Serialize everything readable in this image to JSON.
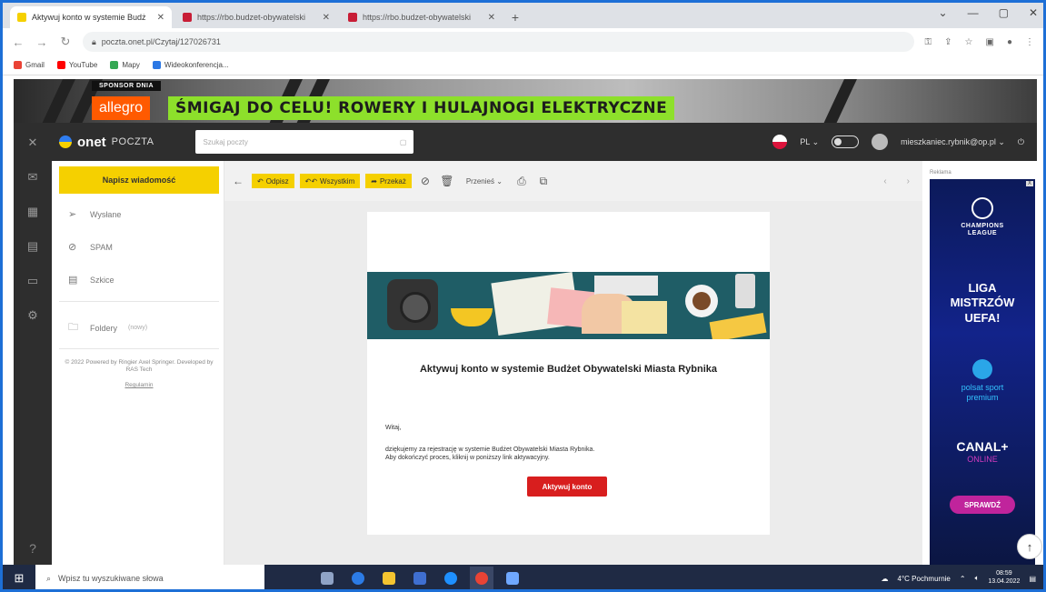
{
  "browser": {
    "tabs": [
      {
        "title": "Aktywuj konto w systemie Budż",
        "favicon_color": "#f5d000"
      },
      {
        "title": "https://rbo.budzet-obywatelski",
        "favicon_color": "#c81d36"
      },
      {
        "title": "https://rbo.budzet-obywatelski",
        "favicon_color": "#c81d36"
      }
    ],
    "url": "poczta.onet.pl/Czytaj/127026731",
    "bookmarks": [
      {
        "label": "Gmail",
        "color": "#ea4335"
      },
      {
        "label": "YouTube",
        "color": "#ff0000"
      },
      {
        "label": "Mapy",
        "color": "#34a853"
      },
      {
        "label": "Wideokonferencja...",
        "color": "#2b78e4"
      }
    ]
  },
  "banner": {
    "sponsor": "SPONSOR DNIA",
    "brand": "allegro",
    "promo": "ŚMIGAJ DO CELU! ROWERY I HULAJNOGI ELEKTRYCZNE"
  },
  "header": {
    "logo": "onet",
    "logo_sub": "POCZTA",
    "search_placeholder": "Szukaj poczty",
    "lang": "PL",
    "user": "mieszkaniec.rybnik@op.pl"
  },
  "sidebar": {
    "compose": "Napisz wiadomość",
    "items": [
      {
        "label": "Wysłane",
        "icon": "send-icon"
      },
      {
        "label": "SPAM",
        "icon": "spam-icon"
      },
      {
        "label": "Szkice",
        "icon": "draft-icon"
      }
    ],
    "folders": "Foldery",
    "folders_hint": "(nowy)",
    "footer": "© 2022 Powered by Ringier Axel Springer. Developed by RAS Tech",
    "footer_link": "Regulamin"
  },
  "toolbar": {
    "reply": "Odpisz",
    "reply_all": "Wszystkim",
    "forward": "Przekaż",
    "move": "Przenieś"
  },
  "email": {
    "title": "Aktywuj konto w systemie Budżet Obywatelski Miasta Rybnika",
    "greeting": "Witaj,",
    "body_line1": "dziękujemy za rejestrację w systemie Budżet Obywatelski Miasta Rybnika.",
    "body_line2": "Aby dokończyć proces, kliknij w poniższy link aktywacyjny.",
    "button": "Aktywuj konto"
  },
  "ad": {
    "label": "Reklama",
    "close": "X",
    "cl_line1": "CHAMPIONS",
    "cl_line2": "LEAGUE",
    "liga1": "LIGA",
    "liga2": "MISTRZÓW",
    "liga3": "UEFA!",
    "polsat1": "polsat sport",
    "polsat2": "premium",
    "canal": "CANAL+",
    "canal_sub": "ONLINE",
    "cta": "SPRAWDŹ"
  },
  "taskbar": {
    "search": "Wpisz tu wyszukiwane słowa",
    "weather": "4°C Pochmurnie",
    "time": "08:59",
    "date": "13.04.2022",
    "apps": [
      "#8fa3c6",
      "#2c7be5",
      "#f4c430",
      "#3f6fd1",
      "#1e90ff",
      "#e94335",
      "#6fa8ff"
    ]
  }
}
